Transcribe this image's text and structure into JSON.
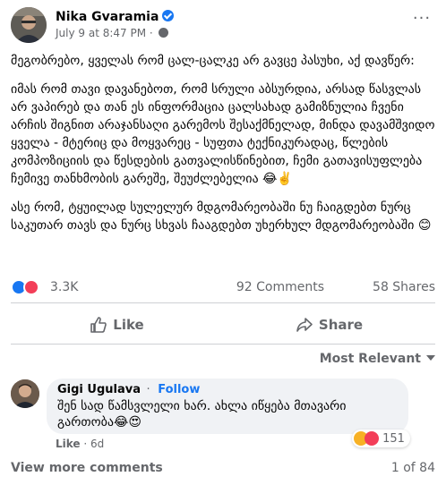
{
  "post": {
    "author": "Nika Gvaramia",
    "timestamp": "July 9 at 8:47 PM",
    "separator": "·",
    "privacy_icon": "globe-icon",
    "more_label": "···",
    "paragraphs": [
      "მეგობრებო, ყველას რომ ცალ-ცალკე არ გავცე პასუხი, აქ დავწერ:",
      "იმას რომ თავი დავანებოთ, რომ სრული აბსურდია, არსად წასვლას არ ვაპირებ და თან ეს ინფორმაცია ცალსახად გამიზნულია ჩვენი არჩის შიგნით არაჯანსაღი გარემოს შესაქმნელად, მინდა დავამშვიდო ყველა - მტერიც და მოყვარეც - სუფთა ტექნიკურადაც, წლების კომპოზიციის და წესდების გათვალისწინებით, ჩემი გათავისუფლება ჩემივე თანხმობის გარეშე, შეუძლებელია 😂✌️",
      "ასე რომ, ტყუილად სულელურ მდგომარეობაში ნუ ჩაიგდებთ ნურც საკუთარ თავს და ნურც სხვას ჩააგდებთ უხერხულ მდგომარეობაში 😊"
    ]
  },
  "reactions": {
    "icons": [
      "like-icon",
      "love-icon"
    ],
    "count": "3.3K",
    "comments": "92 Comments",
    "shares": "58 Shares"
  },
  "actions": {
    "like": "Like",
    "share": "Share"
  },
  "sort": {
    "label": "Most Relevant"
  },
  "comment": {
    "author": "Gigi Ugulava",
    "separator": "·",
    "follow": "Follow",
    "text": "შენ სად წამსვლელი ხარ. ახლა იწყება მთავარი გართობა😂😍",
    "reaction_count": "151",
    "reaction_icons": [
      "haha-icon",
      "love-icon"
    ],
    "like_label": "Like",
    "age": "6d",
    "meta_separator": "·"
  },
  "footer": {
    "view_more": "View more comments",
    "paging": "1 of 84"
  },
  "colors": {
    "brand": "#1877f2",
    "secondary_text": "#65676b",
    "love": "#f33e58",
    "divider": "#ced0d4",
    "bubble": "#f0f2f5"
  }
}
